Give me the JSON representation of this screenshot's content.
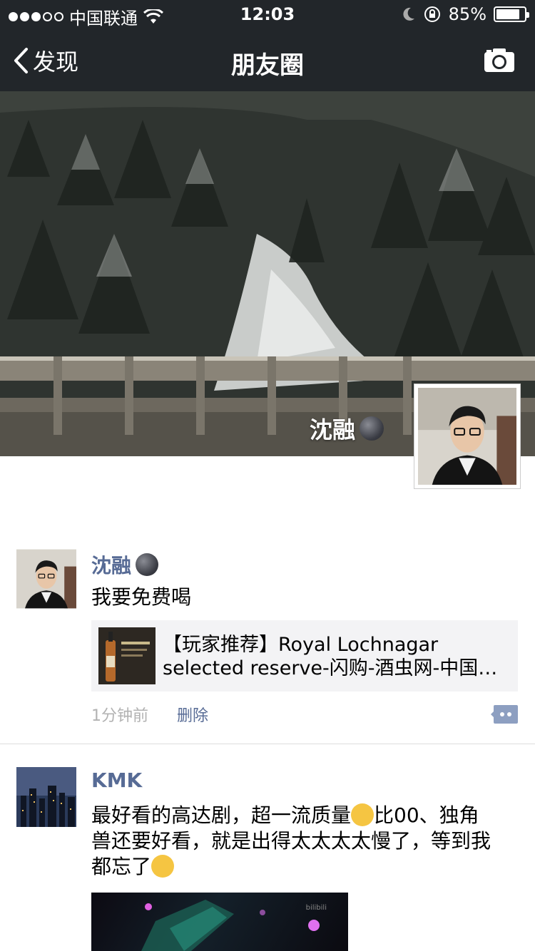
{
  "status_bar": {
    "signal_dots": [
      true,
      true,
      true,
      false,
      false
    ],
    "carrier": "中国联通",
    "time": "12:03",
    "battery": "85%",
    "battery_level": 0.85
  },
  "navbar": {
    "back_label": "发现",
    "title": "朋友圈"
  },
  "cover": {
    "owner_name": "沈融"
  },
  "posts": [
    {
      "author": "沈融",
      "text": "我要免费喝",
      "link_title_line1": "【玩家推荐】Royal Lochnagar",
      "link_title_line2": "selected reserve-闪购-酒虫网-中国…",
      "time": "1分钟前",
      "delete_label": "删除"
    },
    {
      "author": "KMK",
      "text_line1": "最好看的高达剧，超一流质量",
      "text_line1b": "比00、独角",
      "text_line2": "兽还要好看，就是出得太太太太慢了，等到我",
      "text_line3": "都忘了",
      "video_watermark": "bilibili"
    }
  ],
  "colors": {
    "bar_bg": "#22262a",
    "name_link": "#576b95",
    "meta_gray": "#b2b2b2",
    "card_bg": "#f3f3f5"
  }
}
